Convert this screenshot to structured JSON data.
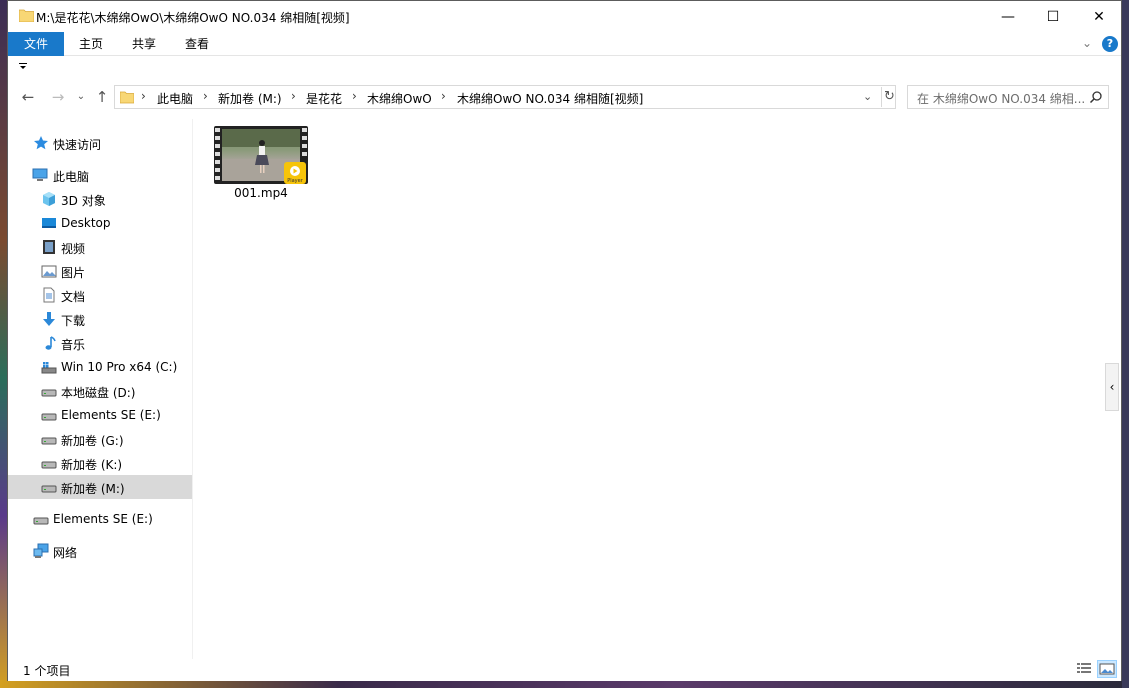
{
  "window": {
    "title": "M:\\是花花\\木绵绵OwO\\木绵绵OwO NO.034 绵相随[视频]",
    "controls": {
      "minimize": "—",
      "maximize": "☐",
      "close": "✕"
    }
  },
  "ribbon": {
    "tabs": [
      {
        "label": "文件",
        "active": true
      },
      {
        "label": "主页"
      },
      {
        "label": "共享"
      },
      {
        "label": "查看"
      }
    ],
    "help": "?"
  },
  "nav_buttons": {
    "back": "←",
    "forward": "→",
    "recent": "⌄",
    "up": "↑"
  },
  "address": {
    "crumbs": [
      "此电脑",
      "新加卷 (M:)",
      "是花花",
      "木绵绵OwO",
      "木绵绵OwO NO.034 绵相随[视频]"
    ],
    "separator": "›",
    "refresh": "↻"
  },
  "search": {
    "placeholder": "在 木绵绵OwO NO.034 绵相..."
  },
  "sidebar": {
    "items": [
      {
        "label": "快速访问",
        "icon": "star-icon",
        "level": 0
      },
      {
        "label": "此电脑",
        "icon": "computer-icon",
        "level": 0
      },
      {
        "label": "3D 对象",
        "icon": "3d-objects-icon",
        "level": 1
      },
      {
        "label": "Desktop",
        "icon": "desktop-icon",
        "level": 1
      },
      {
        "label": "视频",
        "icon": "video-icon",
        "level": 1
      },
      {
        "label": "图片",
        "icon": "pictures-icon",
        "level": 1
      },
      {
        "label": "文档",
        "icon": "documents-icon",
        "level": 1
      },
      {
        "label": "下载",
        "icon": "download-icon",
        "level": 1
      },
      {
        "label": "音乐",
        "icon": "music-icon",
        "level": 1
      },
      {
        "label": "Win 10 Pro x64 (C:)",
        "icon": "system-drive-icon",
        "level": 1
      },
      {
        "label": "本地磁盘 (D:)",
        "icon": "drive-icon",
        "level": 1
      },
      {
        "label": "Elements SE (E:)",
        "icon": "drive-icon",
        "level": 1
      },
      {
        "label": "新加卷 (G:)",
        "icon": "drive-icon",
        "level": 1
      },
      {
        "label": "新加卷 (K:)",
        "icon": "drive-icon",
        "level": 1
      },
      {
        "label": "新加卷 (M:)",
        "icon": "drive-icon",
        "level": 1,
        "selected": true
      },
      {
        "label": "Elements SE (E:)",
        "icon": "drive-icon",
        "level": 0
      },
      {
        "label": "网络",
        "icon": "network-icon",
        "level": 0
      }
    ]
  },
  "files": [
    {
      "name": "001.mp4",
      "type": "video",
      "badge": "Player"
    }
  ],
  "status": {
    "item_count": "1 个项目"
  },
  "colors": {
    "accent": "#1979ca",
    "selection": "#d9d9d9",
    "badge": "#f6c40a"
  }
}
